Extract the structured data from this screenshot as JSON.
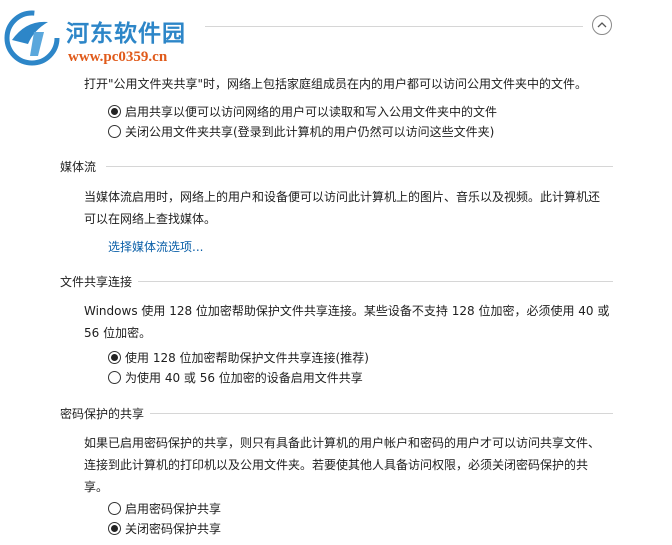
{
  "watermark": {
    "title": "河东软件园",
    "url": "www.pc0359.cn"
  },
  "public_folder": {
    "description": "打开\"公用文件夹共享\"时，网络上包括家庭组成员在内的用户都可以访问公用文件夹中的文件。",
    "options": [
      {
        "label": "启用共享以便可以访问网络的用户可以读取和写入公用文件夹中的文件",
        "selected": true
      },
      {
        "label": "关闭公用文件夹共享(登录到此计算机的用户仍然可以访问这些文件夹)",
        "selected": false
      }
    ]
  },
  "media_streaming": {
    "title": "媒体流",
    "description_line1": "当媒体流启用时，网络上的用户和设备便可以访问此计算机上的图片、音乐以及视频。此计算机还",
    "description_line2": "可以在网络上查找媒体。",
    "link": "选择媒体流选项..."
  },
  "file_sharing_connections": {
    "title": "文件共享连接",
    "description_line1": "Windows 使用 128 位加密帮助保护文件共享连接。某些设备不支持 128 位加密，必须使用 40 或",
    "description_line2": "56 位加密。",
    "options": [
      {
        "label": "使用 128 位加密帮助保护文件共享连接(推荐)",
        "selected": true
      },
      {
        "label": "为使用 40 或 56 位加密的设备启用文件共享",
        "selected": false
      }
    ]
  },
  "password_protected_sharing": {
    "title": "密码保护的共享",
    "description_line1": "如果已启用密码保护的共享，则只有具备此计算机的用户帐户和密码的用户才可以访问共享文件、",
    "description_line2": "连接到此计算机的打印机以及公用文件夹。若要使其他人具备访问权限，必须关闭密码保护的共",
    "description_line3": "享。",
    "options": [
      {
        "label": "启用密码保护共享",
        "selected": false
      },
      {
        "label": "关闭密码保护共享",
        "selected": true
      }
    ]
  }
}
